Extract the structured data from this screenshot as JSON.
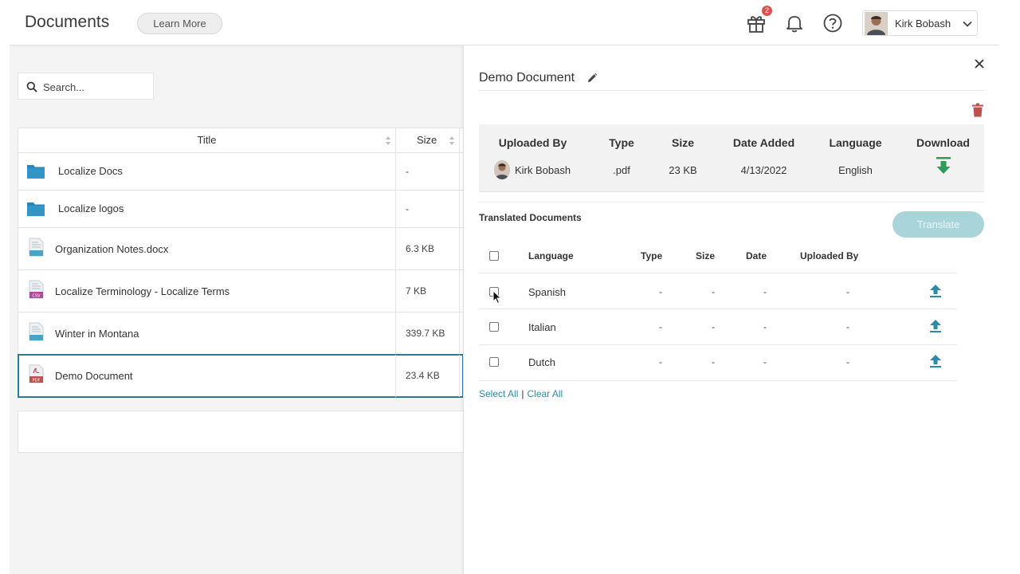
{
  "header": {
    "title": "Documents",
    "learn_more": "Learn More",
    "notification_count": "2",
    "user_name": "Kirk Bobash"
  },
  "search": {
    "placeholder": "Search..."
  },
  "table": {
    "columns": [
      "Title",
      "Size"
    ],
    "rows": [
      {
        "name": "Localize Docs",
        "size": "-",
        "icon": "folder-icon"
      },
      {
        "name": "Localize logos",
        "size": "-",
        "icon": "folder-icon"
      },
      {
        "name": "Organization Notes.docx",
        "size": "6.3 KB",
        "icon": "document-file-icon"
      },
      {
        "name": "Localize Terminology - Localize Terms",
        "size": "7 KB",
        "icon": "csv-file-icon"
      },
      {
        "name": "Winter in Montana",
        "size": "339.7 KB",
        "icon": "document-file-icon"
      },
      {
        "name": "Demo Document",
        "size": "23.4 KB",
        "icon": "pdf-file-icon"
      }
    ]
  },
  "detail": {
    "doc_name": "Demo Document",
    "info_headers": [
      "Uploaded By",
      "Type",
      "Size",
      "Date Added",
      "Language",
      "Download"
    ],
    "uploaded_by": "Kirk Bobash",
    "type": ".pdf",
    "size": "23 KB",
    "date_added": "4/13/2022",
    "language": "English",
    "translated_title": "Translated Documents",
    "translate_button": "Translate",
    "trans_headers": [
      "Language",
      "Type",
      "Size",
      "Date",
      "Uploaded By"
    ],
    "translations": [
      {
        "language": "Spanish",
        "type": "-",
        "size": "-",
        "date": "-",
        "uploaded_by": "-"
      },
      {
        "language": "Italian",
        "type": "-",
        "size": "-",
        "date": "-",
        "uploaded_by": "-"
      },
      {
        "language": "Dutch",
        "type": "-",
        "size": "-",
        "date": "-",
        "uploaded_by": "-"
      }
    ],
    "select_all": "Select All",
    "clear_all": "Clear All"
  },
  "colors": {
    "accent": "#2a8ca8",
    "folder": "#2a86b8",
    "download": "#2e9b5a",
    "trash": "#c0504d",
    "translate_disabled": "#a9d5da"
  }
}
